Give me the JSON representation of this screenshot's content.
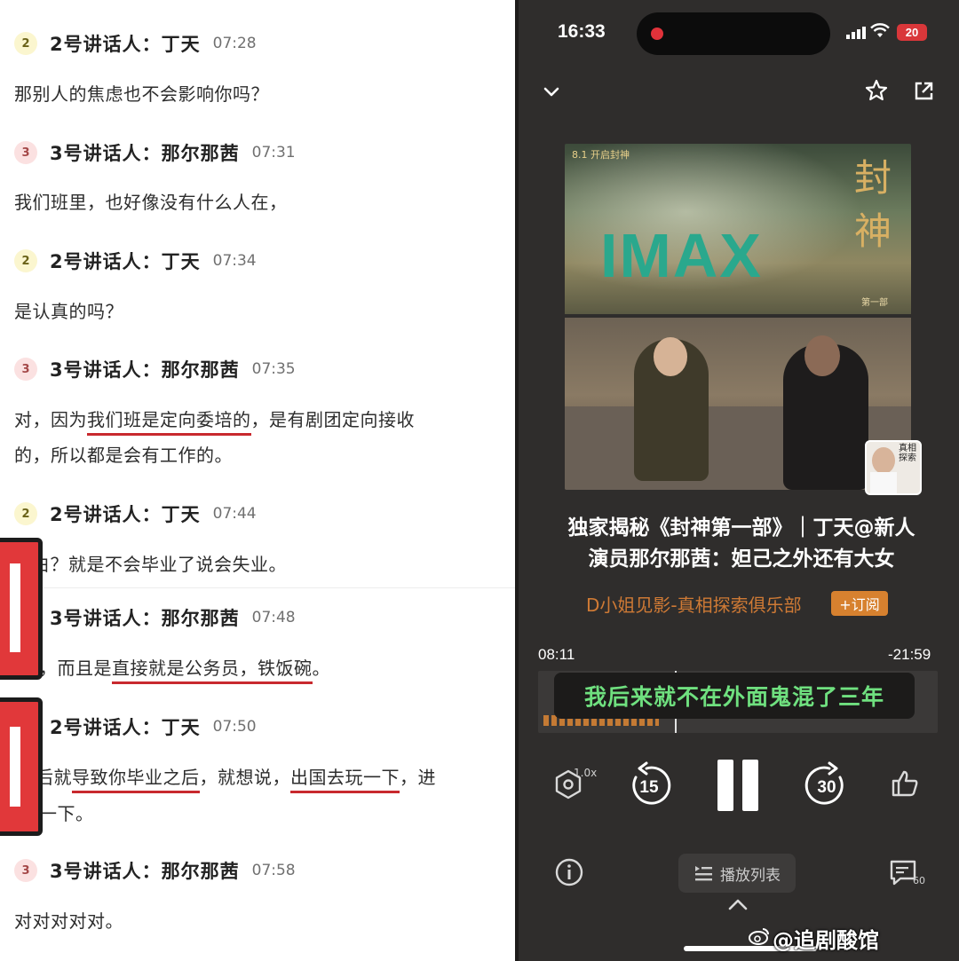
{
  "transcript": {
    "speaker2_badge": "2",
    "speaker3_badge": "3",
    "speaker2_name": "2号讲话人：丁天",
    "speaker3_name": "3号讲话人：那尔那茜",
    "entries": [
      {
        "time": "07:28",
        "lines": [
          "那别人的焦虑也不会影响你吗？"
        ]
      },
      {
        "time": "07:31",
        "lines": [
          "我们班里，也好像没有什么人在，"
        ]
      },
      {
        "time": "07:34",
        "lines": [
          "是认真的吗？"
        ]
      },
      {
        "time": "07:35",
        "line1_a": "对，因为",
        "line1_u": "我们班是定向委培的",
        "line1_b": "，是有剧团定向接收",
        "line2": "的，所以都是会有工作的。"
      },
      {
        "time": "07:44",
        "line1": "白？就是不会毕业了说会失业。"
      },
      {
        "time": "07:48",
        "line1_a": "，而且是",
        "line1_u": "直接就是公务员，铁饭碗",
        "line1_b": "。"
      },
      {
        "time": "07:50",
        "line1_a": "后就",
        "line1_u": "导致你毕业之后",
        "line1_b": "，就想说，",
        "line1_u2": "出国去玩一下",
        "line1_c": "，进",
        "line2": "一下。"
      },
      {
        "time": "07:58",
        "line1": "对对对对对。"
      }
    ]
  },
  "phone": {
    "status_time": "16:33",
    "battery": "20",
    "cover": {
      "poster_tagline": "8.1 开启封神",
      "imax_text": "IMAX",
      "film_chars": "封神",
      "film_sub": "第一部",
      "thumb_text": "真相探索"
    },
    "episode_title": "独家揭秘《封神第一部》｜丁天@新人演员那尔那茜：妲己之外还有大女",
    "channel_name": "D小姐见影-真相探索俱乐部",
    "subscribe_label": "+订阅",
    "elapsed": "08:11",
    "remaining": "-21:59",
    "subtitle": "我后来就不在外面鬼混了三年",
    "speed_label": "1.0x",
    "skip_back": "15",
    "skip_forward": "30",
    "playlist_label": "播放列表",
    "comment_count": "60",
    "watermark": "@追剧酸馆",
    "icons": [
      "chevron-down-icon",
      "star-icon",
      "share-icon",
      "speed-icon",
      "rewind-15-icon",
      "pause-icon",
      "forward-30-icon",
      "thumbs-up-icon",
      "info-icon",
      "playlist-icon",
      "comment-icon",
      "chevron-up-icon",
      "weibo-icon"
    ]
  }
}
